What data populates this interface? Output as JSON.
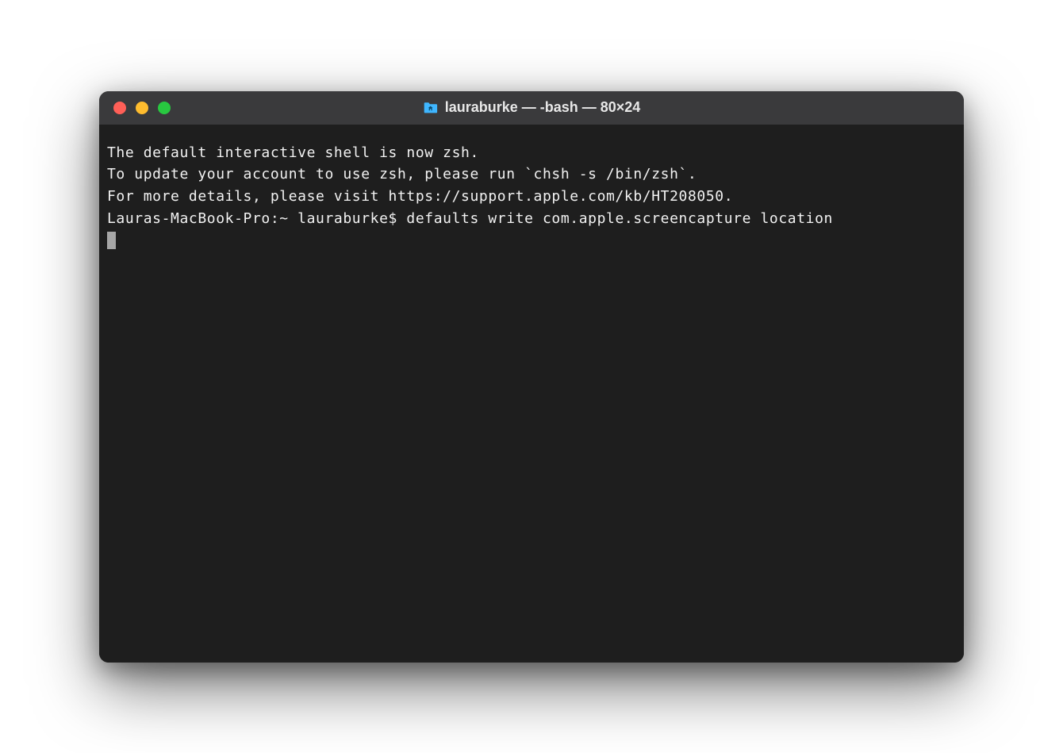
{
  "window": {
    "title": "lauraburke — -bash — 80×24"
  },
  "terminal": {
    "lines": [
      "The default interactive shell is now zsh.",
      "To update your account to use zsh, please run `chsh -s /bin/zsh`.",
      "For more details, please visit https://support.apple.com/kb/HT208050."
    ],
    "prompt": "Lauras-MacBook-Pro:~ lauraburke$ ",
    "command": "defaults write com.apple.screencapture location "
  },
  "colors": {
    "close": "#ff5f57",
    "minimize": "#febc2e",
    "maximize": "#28c840",
    "titlebar_bg": "#3a3a3c",
    "terminal_bg": "#1e1e1e",
    "text": "#f2f2f2",
    "folder_icon": "#3fb6ff"
  },
  "icons": {
    "folder": "folder-home-icon"
  }
}
